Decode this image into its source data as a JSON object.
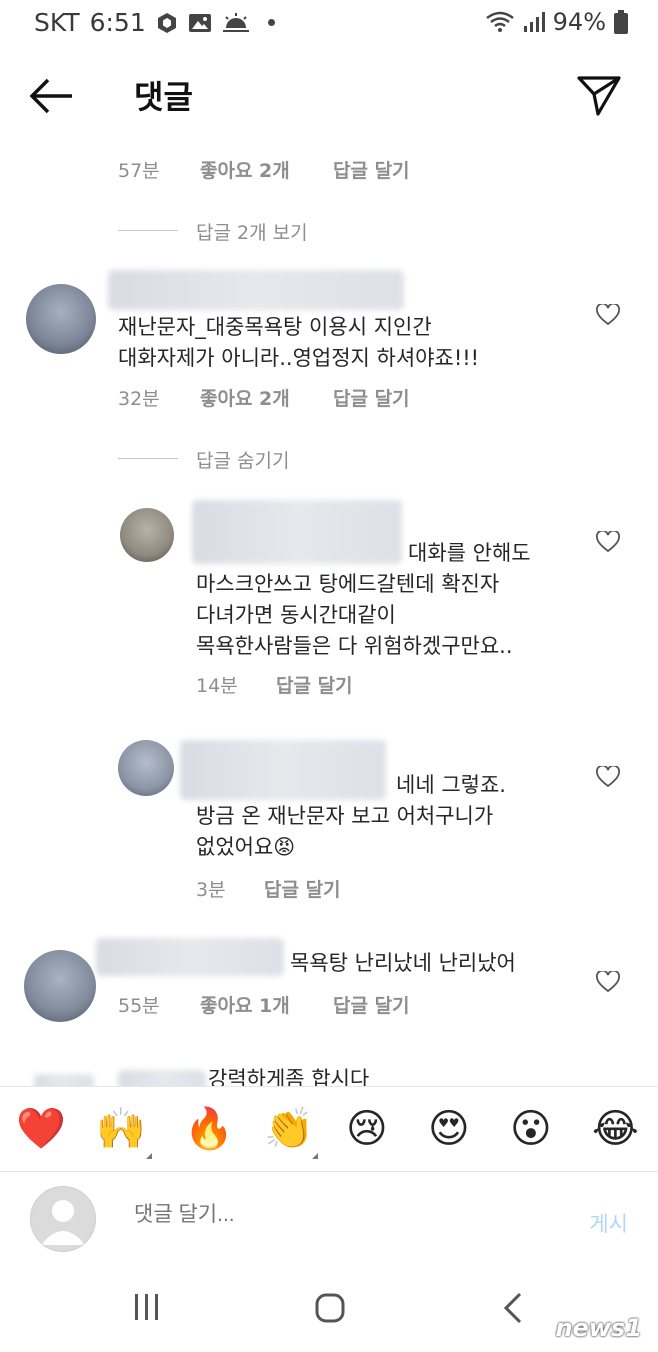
{
  "status_bar": {
    "carrier": "SKT",
    "time": "6:51",
    "battery": "94%"
  },
  "header": {
    "title": "댓글"
  },
  "top_meta": {
    "time": "57분",
    "likes": "좋아요 2개",
    "reply": "답글 달기"
  },
  "view_replies": "답글 2개 보기",
  "comment1": {
    "line1": "재난문자_대중목욕탕 이용시 지인간",
    "line2": "대화자제가 아니라..영업정지 하셔야죠!!!",
    "time": "32분",
    "likes": "좋아요 2개",
    "reply": "답글 달기"
  },
  "hide_replies": "답글 숨기기",
  "reply1": {
    "line1": "대화를  안해도",
    "line2": "마스크안쓰고 탕에드갈텐데 확진자",
    "line3": "다녀가면 동시간대같이",
    "line4": "목욕한사람들은 다 위험하겠구만요..",
    "time": "14분",
    "reply": "답글 달기"
  },
  "reply2": {
    "line1": "네네 그렇죠.",
    "line2": "방금 온 재난문자 보고 어처구니가",
    "line3": "없었어요😡",
    "time": "3분",
    "reply": "답글 달기"
  },
  "comment2": {
    "line1": "목욕탕 난리났네 난리났어",
    "time": "55분",
    "likes": "좋아요 1개",
    "reply": "답글 달기"
  },
  "comment3_partial": "강력하게좀 합시다",
  "emojis": [
    "❤️",
    "🙌",
    "🔥",
    "👏",
    "😢",
    "😍",
    "😮",
    "😂"
  ],
  "comment_input": {
    "placeholder": "댓글 달기...",
    "post_label": "게시"
  },
  "watermark": "news1",
  "colors": {
    "meta_gray": "#8e8e8e",
    "post_blue": "#b3d6f5",
    "heart_red": "#ed4956"
  }
}
